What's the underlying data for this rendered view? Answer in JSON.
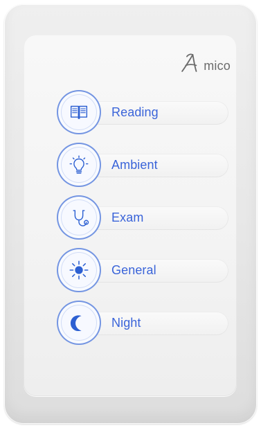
{
  "brand": {
    "name_text": "mico"
  },
  "modes": [
    {
      "label": "Reading",
      "icon": "book-icon"
    },
    {
      "label": "Ambient",
      "icon": "lightbulb-icon"
    },
    {
      "label": "Exam",
      "icon": "stethoscope-icon"
    },
    {
      "label": "General",
      "icon": "sun-icon"
    },
    {
      "label": "Night",
      "icon": "moon-icon"
    }
  ],
  "colors": {
    "accent": "#3a64d9",
    "accent_strong": "#2d60d2",
    "body": "#e9e9e9",
    "panel": "#f4f4f4",
    "brand_gray": "#6b6b6b"
  }
}
